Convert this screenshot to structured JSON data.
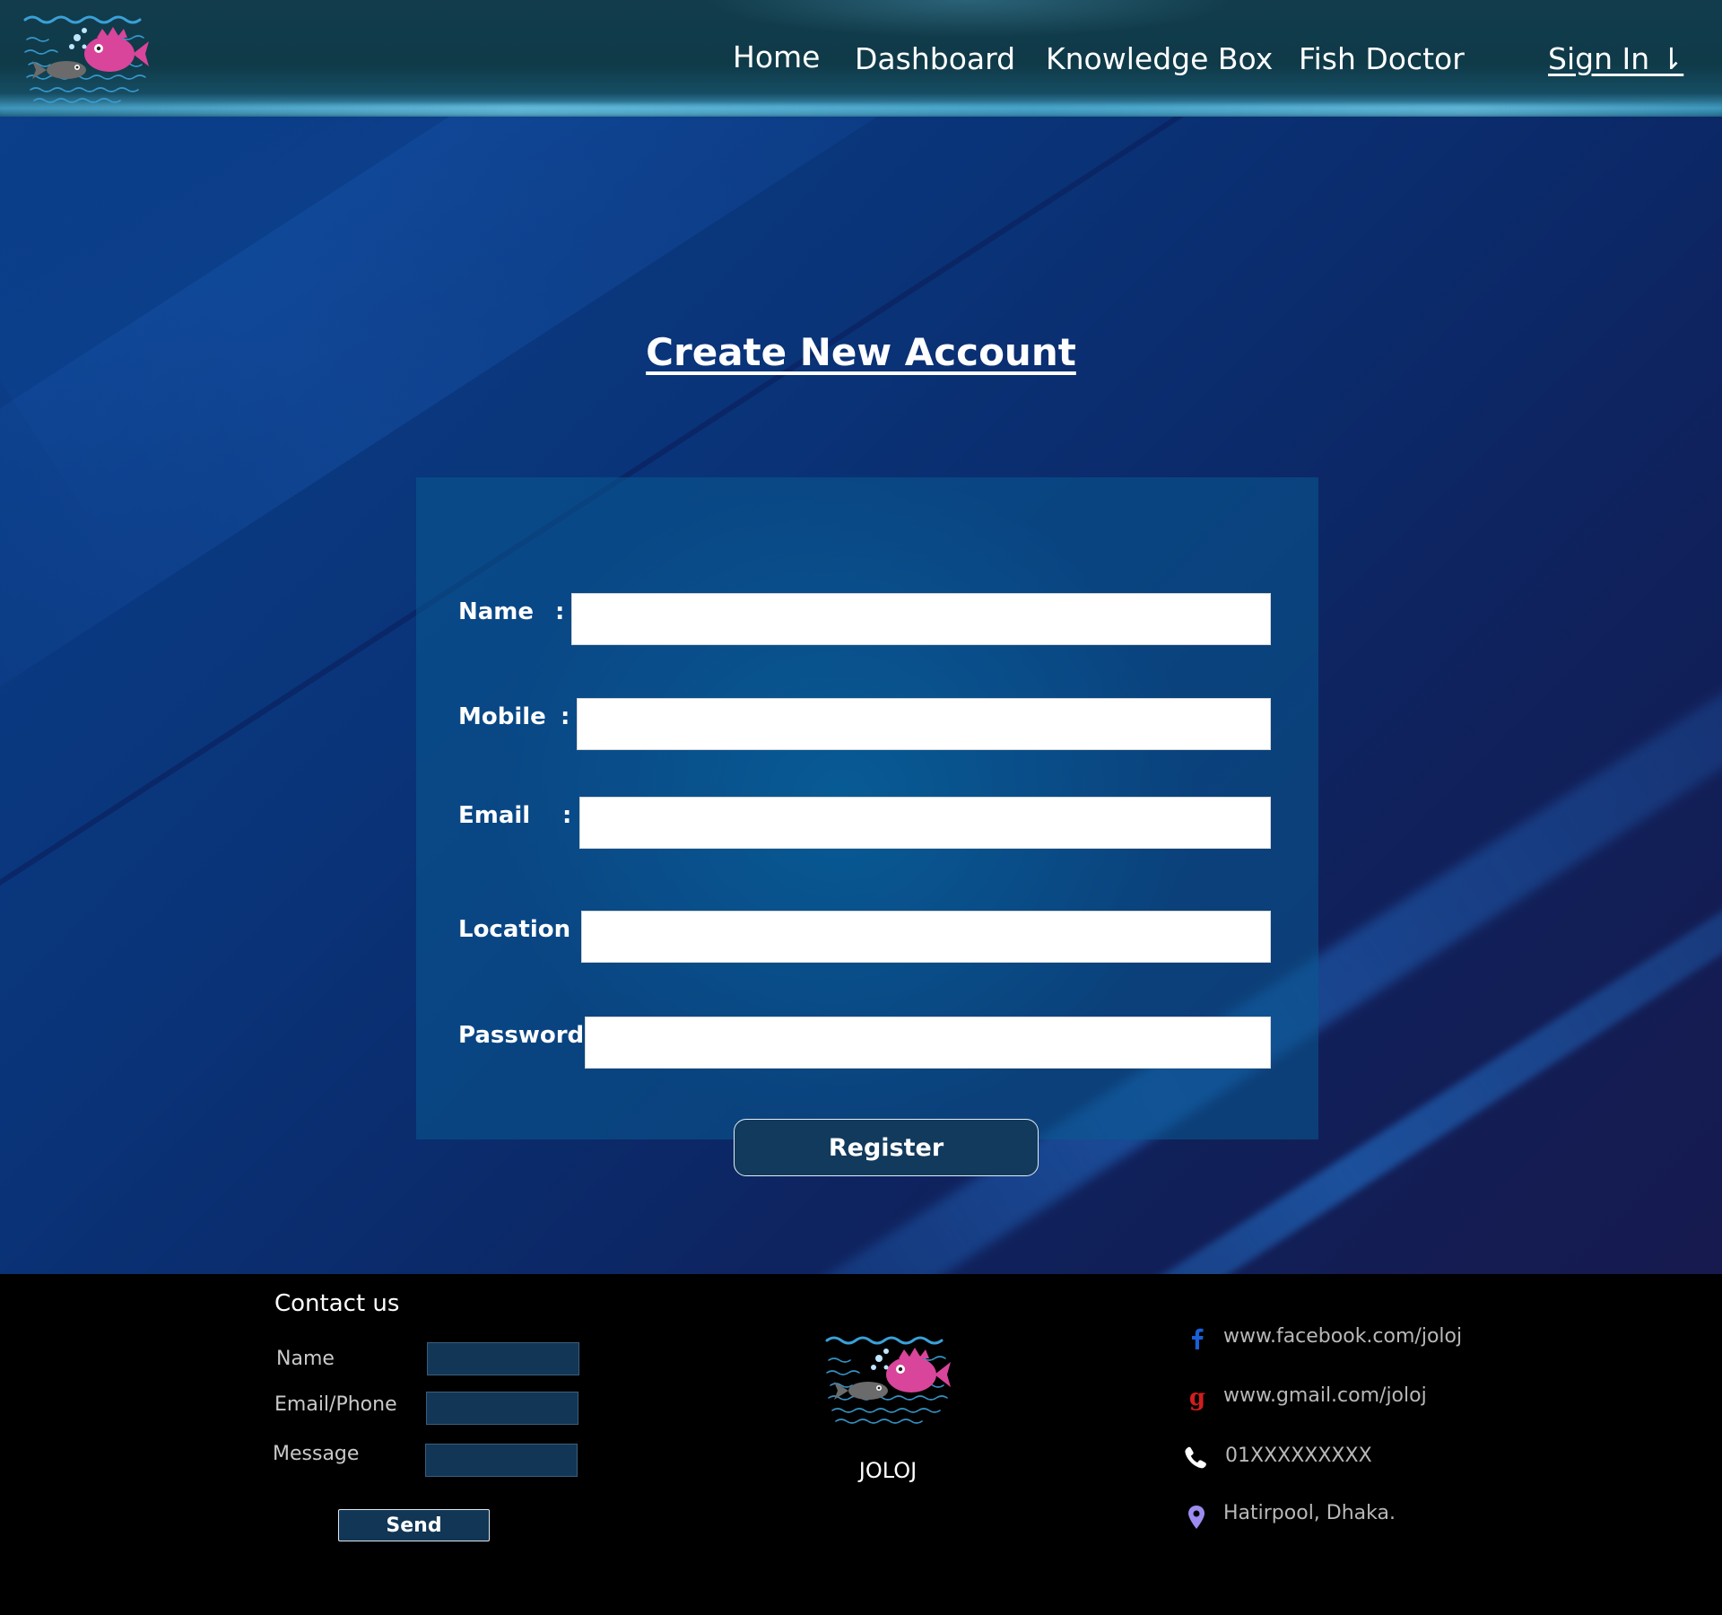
{
  "header": {
    "nav": {
      "home": "Home",
      "dashboard": "Dashboard",
      "knowledge_box": "Knowledge Box",
      "fish_doctor": "Fish Doctor",
      "sign_in": "Sign In ⇂"
    },
    "logo_icon": "fish-logo-icon"
  },
  "main": {
    "title": "Create New Account",
    "form": {
      "name_label": "Name",
      "mobile_label": "Mobile",
      "email_label": "Email",
      "location_label": "Location :",
      "password_label": "Password:",
      "colon": ":",
      "name_value": "",
      "mobile_value": "",
      "email_value": "",
      "location_value": "",
      "password_value": ""
    },
    "register_label": "Register"
  },
  "footer": {
    "contact_title": "Contact us",
    "contact_form": {
      "name_label": "Name",
      "email_phone_label": "Email/Phone",
      "message_label": "Message",
      "send_label": "Send"
    },
    "brand": "JOLOJ",
    "contacts": {
      "facebook": "www.facebook.com/joloj",
      "gmail": "www.gmail.com/joloj",
      "phone": "01XXXXXXXXX",
      "location": "Hatirpool, Dhaka."
    }
  },
  "colors": {
    "facebook_blue": "#1a5fd6",
    "google_red": "#d11d1d",
    "location_purple": "#9b8cf0",
    "logo_pink": "#d9459a",
    "logo_gray": "#6b6b6b",
    "logo_water": "#3aa0d8"
  }
}
